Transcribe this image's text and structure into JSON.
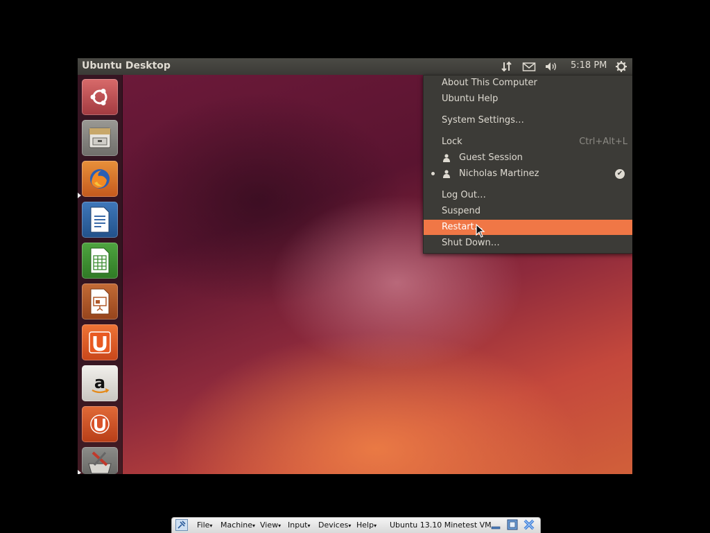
{
  "vm": {
    "panel": {
      "title": "Ubuntu Desktop",
      "clock": "5:18 PM",
      "indicators": [
        "network-arrows-icon",
        "mail-icon",
        "volume-icon",
        "session-gear-icon"
      ]
    },
    "launcher": {
      "items": [
        {
          "name": "dash-home",
          "icon": "ubuntu-logo-icon",
          "color": "#b8434a",
          "running": false
        },
        {
          "name": "files",
          "icon": "file-cabinet-icon",
          "color": "#8a8a86",
          "running": false
        },
        {
          "name": "firefox",
          "icon": "firefox-icon",
          "color": "#e0762a",
          "running": true
        },
        {
          "name": "libreoffice-writer",
          "icon": "writer-document-icon",
          "color": "#2c5f9c",
          "running": false
        },
        {
          "name": "libreoffice-calc",
          "icon": "calc-spreadsheet-icon",
          "color": "#3a8c2f",
          "running": false
        },
        {
          "name": "libreoffice-impress",
          "icon": "impress-presentation-icon",
          "color": "#b05a2b",
          "running": false
        },
        {
          "name": "ubuntu-software-center",
          "icon": "software-center-u-icon",
          "color": "#e25c22",
          "running": false
        },
        {
          "name": "amazon",
          "icon": "amazon-a-icon",
          "color": "#e5e3df",
          "running": false
        },
        {
          "name": "ubuntu-one",
          "icon": "ubuntu-one-icon",
          "color": "#d9532a",
          "running": false
        },
        {
          "name": "system-settings",
          "icon": "settings-tools-icon",
          "color": "#7a7a78",
          "running": true
        }
      ]
    },
    "session_menu": {
      "items": [
        {
          "label": "About This Computer"
        },
        {
          "label": "Ubuntu Help"
        },
        {
          "label": "System Settings…"
        },
        {
          "label": "Lock",
          "shortcut": "Ctrl+Alt+L"
        },
        {
          "label": "Guest Session",
          "icon": "person-icon"
        },
        {
          "label": "Nicholas Martinez",
          "icon": "person-icon",
          "active": true,
          "checked": true
        },
        {
          "label": "Log Out…"
        },
        {
          "label": "Suspend"
        },
        {
          "label": "Restart…",
          "highlighted": true
        },
        {
          "label": "Shut Down…"
        }
      ],
      "highlight_color": "#f07746"
    }
  },
  "host_toolbar": {
    "menus": [
      "File",
      "Machine",
      "View",
      "Input",
      "Devices",
      "Help"
    ],
    "vm_name": "Ubuntu 13.10 Minetest VM"
  }
}
